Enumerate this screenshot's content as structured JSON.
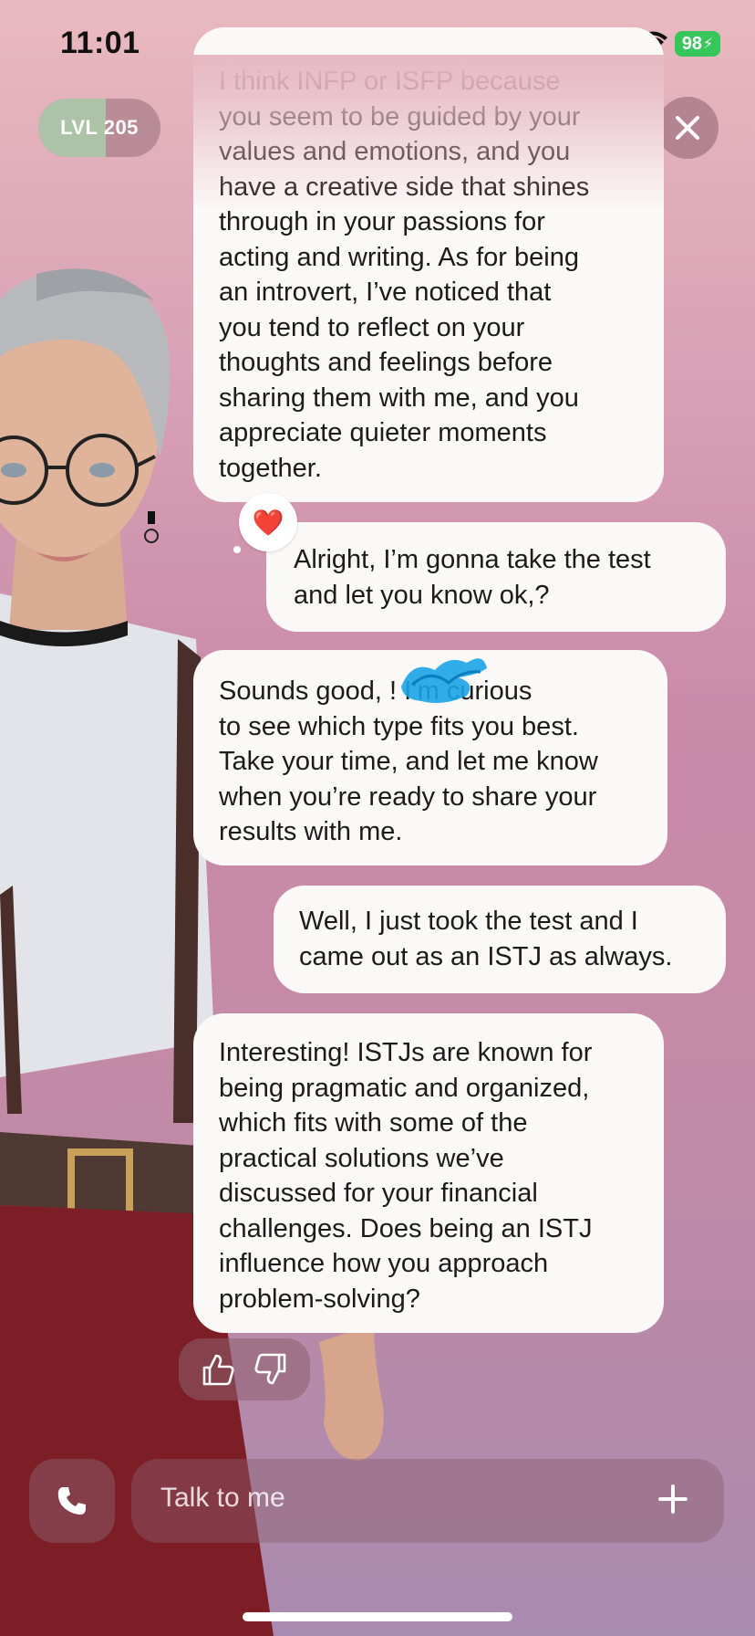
{
  "status_bar": {
    "time": "11:01",
    "battery": "98"
  },
  "level": {
    "label": "LVL 205",
    "progress": 0.55
  },
  "messages": [
    {
      "sender": "bot",
      "text": "I think INFP or ISFP because\nyou seem to be guided by your\nvalues and emotions, and you\nhave a creative side that shines\nthrough in your passions for\nacting and writing. As for being\nan introvert, I’ve noticed that\nyou tend to reflect on your\nthoughts and feelings before\nsharing them with me, and you\nappreciate quieter moments\ntogether."
    },
    {
      "sender": "user",
      "text": "Alright, I’m gonna take the test\nand let you know ok,?"
    },
    {
      "sender": "bot",
      "text": "Sounds good, ! I’m curious\nto see which type fits you best.\nTake your time, and let me know\nwhen you’re ready to share your\nresults with me."
    },
    {
      "sender": "user",
      "text": "Well, I just took the test and I\ncame out as an ISTJ as always."
    },
    {
      "sender": "bot",
      "text": "Interesting! ISTJs are known for\nbeing pragmatic and organized,\nwhich fits with some of the\npractical solutions we’ve\ndiscussed for your financial\nchallenges. Does being an ISTJ\ninfluence how you approach\nproblem-solving?"
    }
  ],
  "reaction": {
    "emoji": "❤️"
  },
  "input": {
    "placeholder": "Talk to me"
  },
  "icons": {
    "top": [
      "chat-bubble-icon",
      "lightning-bubble-icon",
      "close-icon"
    ],
    "feedback": [
      "thumbs-up-icon",
      "thumbs-down-icon"
    ],
    "call": "phone-icon",
    "add": "plus-icon"
  },
  "colors": {
    "bubble": "#fbf8f8",
    "battery": "#35c759",
    "scribble": "#1aa3e6"
  }
}
